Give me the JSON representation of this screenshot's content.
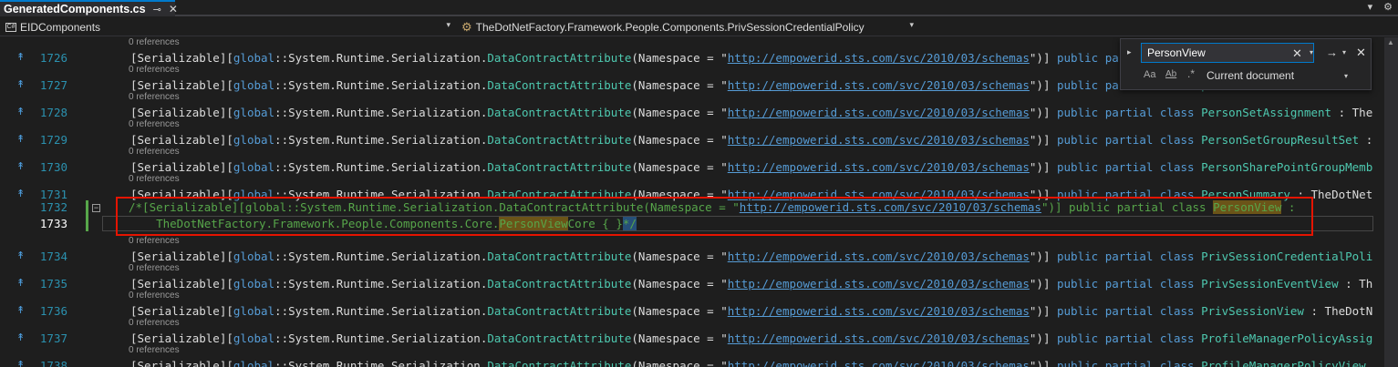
{
  "tab": {
    "title": "GeneratedComponents.cs",
    "pin_icon": "pin-icon",
    "close_icon": "close-icon"
  },
  "tabbar_right": {
    "dropdown_glyph": "▾",
    "settings_glyph": "⚙"
  },
  "navbar": {
    "project": "EIDComponents",
    "member": "TheDotNetFactory.Framework.People.Components.PrivSessionCredentialPolicy"
  },
  "find": {
    "query": "PersonView",
    "scope": "Current document",
    "case_label": "Aa",
    "word_label": "Ab",
    "regex_label": ".*"
  },
  "tokens": {
    "ref": "0 references",
    "serializable": "[Serializable]",
    "global": "global",
    "ns_sep": "::System.Runtime.Serialization.",
    "dca": "DataContractAttribute",
    "ns_arg_open": "(Namespace = \"",
    "url": "http://empowerid.sts.com/svc/2010/03/schemas",
    "ns_arg_close": "\")] ",
    "public": "public",
    "partial": "partial",
    "class": "class"
  },
  "lines": [
    {
      "num": "1726",
      "class_name": "par",
      "suffix": ""
    },
    {
      "num": "1727",
      "class_name": "par",
      "suffix": ""
    },
    {
      "num": "1728",
      "class_name": "PersonSetAssignment",
      "suffix": " : The"
    },
    {
      "num": "1729",
      "class_name": "PersonSetGroupResultSet",
      "suffix": " :"
    },
    {
      "num": "1730",
      "class_name": "PersonSharePointGroupMemb",
      "suffix": ""
    },
    {
      "num": "1731",
      "class_name": "PersonSummary",
      "suffix": " : TheDotNet"
    },
    {
      "num": "1734",
      "class_name": "PrivSessionCredentialPoli",
      "suffix": ""
    },
    {
      "num": "1735",
      "class_name": "PrivSessionEventView",
      "suffix": " : Th"
    },
    {
      "num": "1736",
      "class_name": "PrivSessionView",
      "suffix": " : TheDotN"
    },
    {
      "num": "1737",
      "class_name": "ProfileManagerPolicyAssig",
      "suffix": ""
    },
    {
      "num": "1738",
      "class_name": "ProfileManagerPolicyView",
      "suffix": ""
    }
  ],
  "commented": {
    "num1": "1732",
    "num2": "1733",
    "line1_prefix": "/*[Serializable][global::System.Runtime.Serialization.DataContractAttribute(Namespace = \"",
    "line1_url": "http://empowerid.sts.com/svc/2010/03/schemas",
    "line1_mid": "\")] public partial class ",
    "match1": "PersonView",
    "line1_tail": " :",
    "line2_prefix": "    TheDotNetFactory.Framework.People.Components.Core.",
    "match2": "PersonView",
    "line2_mid": "Core { }",
    "line2_end": "*/"
  }
}
